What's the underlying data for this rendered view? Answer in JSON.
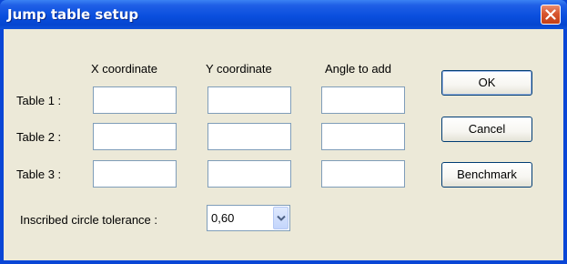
{
  "window": {
    "title": "Jump table setup"
  },
  "columns": {
    "x": "X coordinate",
    "y": "Y coordinate",
    "angle": "Angle to add"
  },
  "rows": [
    {
      "label": "Table 1 :",
      "x": "",
      "y": "",
      "angle": ""
    },
    {
      "label": "Table 2 :",
      "x": "",
      "y": "",
      "angle": ""
    },
    {
      "label": "Table 3 :",
      "x": "",
      "y": "",
      "angle": ""
    }
  ],
  "tolerance": {
    "label": "Inscribed circle tolerance :",
    "value": "0,60"
  },
  "buttons": {
    "ok": "OK",
    "cancel": "Cancel",
    "benchmark": "Benchmark"
  },
  "icons": {
    "close": "close-icon",
    "dropdown": "chevron-down-icon"
  },
  "colors": {
    "titlebar": "#0a4fde",
    "client": "#ece9d8",
    "close": "#d8562f",
    "field_border": "#7f9db9"
  }
}
